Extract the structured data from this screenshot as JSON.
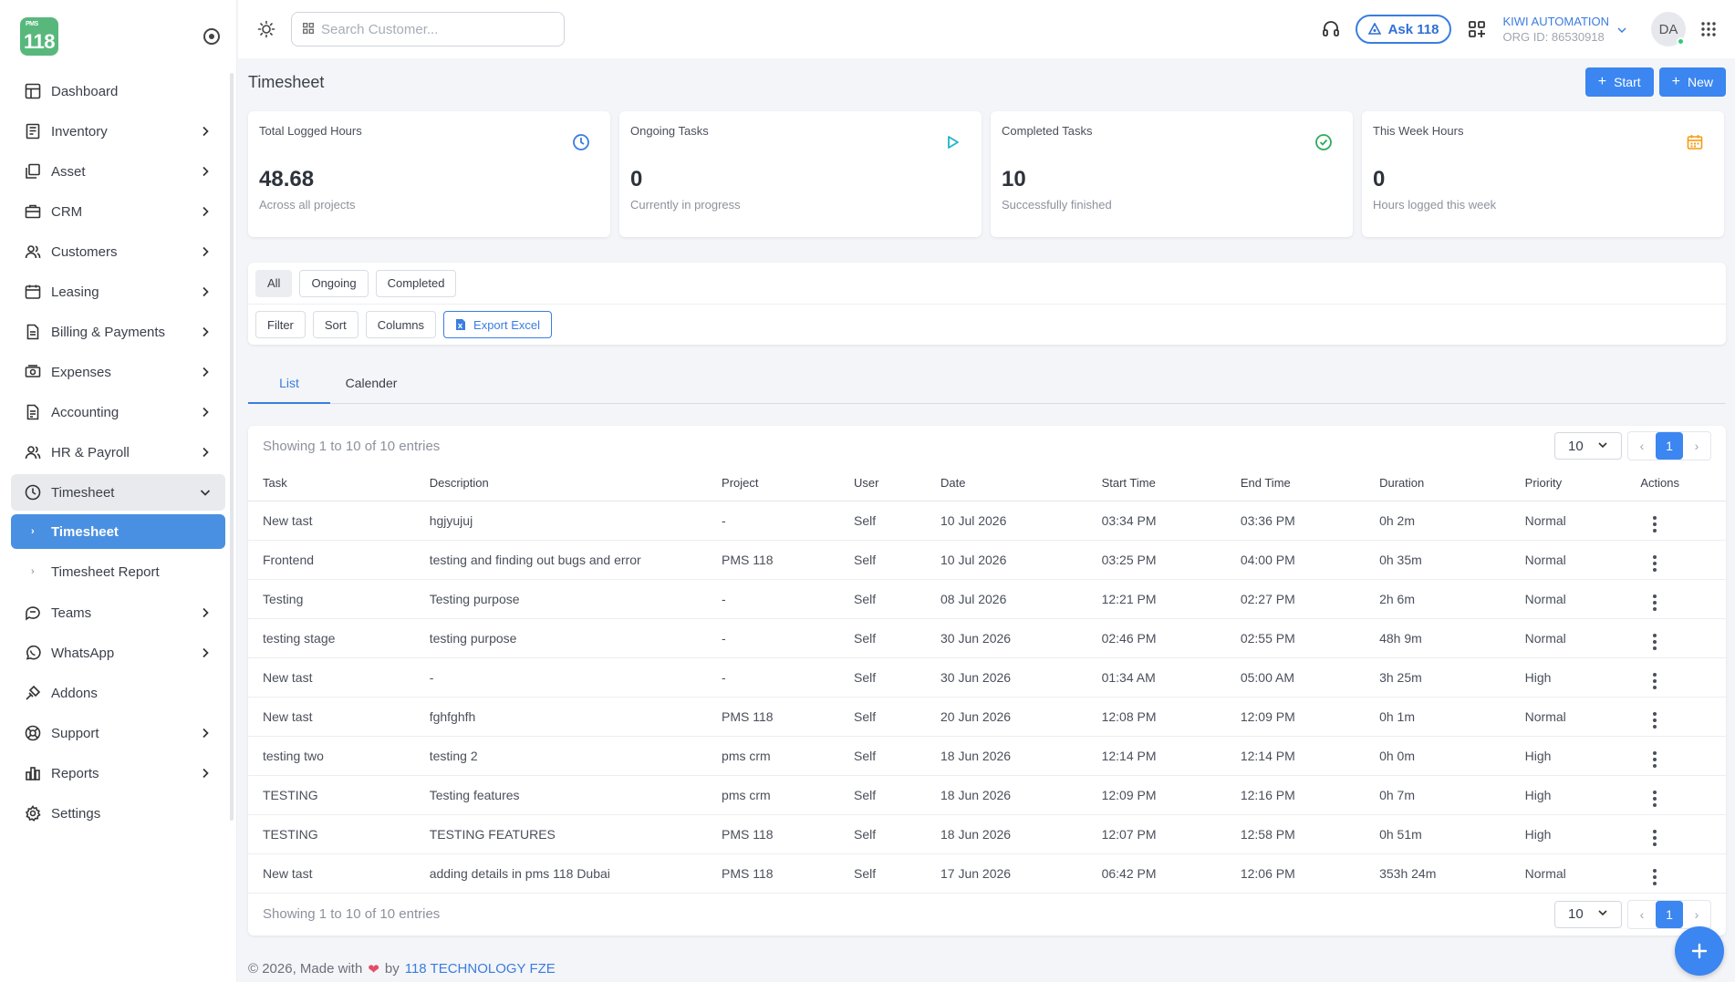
{
  "logo": {
    "text": "118",
    "small": "PMS"
  },
  "sidebar": {
    "items": [
      {
        "label": "Dashboard",
        "icon": "dashboard-icon",
        "has_chevron": false
      },
      {
        "label": "Inventory",
        "icon": "inventory-icon",
        "has_chevron": true
      },
      {
        "label": "Asset",
        "icon": "asset-icon",
        "has_chevron": true
      },
      {
        "label": "CRM",
        "icon": "crm-icon",
        "has_chevron": true
      },
      {
        "label": "Customers",
        "icon": "customers-icon",
        "has_chevron": true
      },
      {
        "label": "Leasing",
        "icon": "leasing-icon",
        "has_chevron": true
      },
      {
        "label": "Billing & Payments",
        "icon": "billing-icon",
        "has_chevron": true
      },
      {
        "label": "Expenses",
        "icon": "expenses-icon",
        "has_chevron": true
      },
      {
        "label": "Accounting",
        "icon": "accounting-icon",
        "has_chevron": true
      },
      {
        "label": "HR & Payroll",
        "icon": "hr-icon",
        "has_chevron": true
      },
      {
        "label": "Timesheet",
        "icon": "clock-icon",
        "has_chevron": true,
        "open": true
      },
      {
        "label": "Teams",
        "icon": "teams-icon",
        "has_chevron": true
      },
      {
        "label": "WhatsApp",
        "icon": "whatsapp-icon",
        "has_chevron": true
      },
      {
        "label": "Addons",
        "icon": "addons-icon",
        "has_chevron": false
      },
      {
        "label": "Support",
        "icon": "support-icon",
        "has_chevron": true
      },
      {
        "label": "Reports",
        "icon": "reports-icon",
        "has_chevron": true
      },
      {
        "label": "Settings",
        "icon": "settings-icon",
        "has_chevron": false
      }
    ],
    "sub_items": [
      {
        "label": "Timesheet",
        "active": true
      },
      {
        "label": "Timesheet Report",
        "active": false
      }
    ]
  },
  "topbar": {
    "search_placeholder": "Search Customer...",
    "ask_label": "Ask 118",
    "org_name": "KIWI AUTOMATION",
    "org_id": "ORG ID: 86530918",
    "avatar_initials": "DA"
  },
  "page": {
    "title": "Timesheet",
    "start_label": "Start",
    "new_label": "New"
  },
  "cards": [
    {
      "title": "Total Logged Hours",
      "value": "48.68",
      "sub": "Across all projects",
      "icon": "clock-icon",
      "color": "#3a7de0"
    },
    {
      "title": "Ongoing Tasks",
      "value": "0",
      "sub": "Currently in progress",
      "icon": "play-icon",
      "color": "#1fb5c9"
    },
    {
      "title": "Completed Tasks",
      "value": "10",
      "sub": "Successfully finished",
      "icon": "check-circle-icon",
      "color": "#2eaa5c"
    },
    {
      "title": "This Week Hours",
      "value": "0",
      "sub": "Hours logged this week",
      "icon": "calendar-icon",
      "color": "#f39c12"
    }
  ],
  "filters": {
    "status_chips": [
      "All",
      "Ongoing",
      "Completed"
    ],
    "tool_chips": [
      "Filter",
      "Sort",
      "Columns"
    ],
    "export_label": "Export Excel"
  },
  "tabs": [
    "List",
    "Calender"
  ],
  "table": {
    "showing": "Showing 1 to 10 of 10 entries",
    "page_size": "10",
    "current_page": "1",
    "columns": [
      "Task",
      "Description",
      "Project",
      "User",
      "Date",
      "Start Time",
      "End Time",
      "Duration",
      "Priority",
      "Actions"
    ],
    "rows": [
      [
        "New tast",
        "hgjyujuj",
        "-",
        "Self",
        "10 Jul 2026",
        "03:34 PM",
        "03:36 PM",
        "0h 2m",
        "Normal"
      ],
      [
        "Frontend",
        "testing and finding out bugs and error",
        "PMS 118",
        "Self",
        "10 Jul 2026",
        "03:25 PM",
        "04:00 PM",
        "0h 35m",
        "Normal"
      ],
      [
        "Testing",
        "Testing purpose",
        "-",
        "Self",
        "08 Jul 2026",
        "12:21 PM",
        "02:27 PM",
        "2h 6m",
        "Normal"
      ],
      [
        "testing stage",
        "testing purpose",
        "-",
        "Self",
        "30 Jun 2026",
        "02:46 PM",
        "02:55 PM",
        "48h 9m",
        "Normal"
      ],
      [
        "New tast",
        "-",
        "-",
        "Self",
        "30 Jun 2026",
        "01:34 AM",
        "05:00 AM",
        "3h 25m",
        "High"
      ],
      [
        "New tast",
        "fghfghfh",
        "PMS 118",
        "Self",
        "20 Jun 2026",
        "12:08 PM",
        "12:09 PM",
        "0h 1m",
        "Normal"
      ],
      [
        "testing two",
        "testing 2",
        "pms crm",
        "Self",
        "18 Jun 2026",
        "12:14 PM",
        "12:14 PM",
        "0h 0m",
        "High"
      ],
      [
        "TESTING",
        "Testing features",
        "pms crm",
        "Self",
        "18 Jun 2026",
        "12:09 PM",
        "12:16 PM",
        "0h 7m",
        "High"
      ],
      [
        "TESTING",
        "TESTING FEATURES",
        "PMS 118",
        "Self",
        "18 Jun 2026",
        "12:07 PM",
        "12:58 PM",
        "0h 51m",
        "High"
      ],
      [
        "New tast",
        "adding details in pms 118 Dubai",
        "PMS 118",
        "Self",
        "17 Jun 2026",
        "06:42 PM",
        "12:06 PM",
        "353h 24m",
        "Normal"
      ]
    ]
  },
  "footer": {
    "prefix": "© 2026, Made with",
    "by": "by",
    "brand": "118 TECHNOLOGY FZE"
  }
}
